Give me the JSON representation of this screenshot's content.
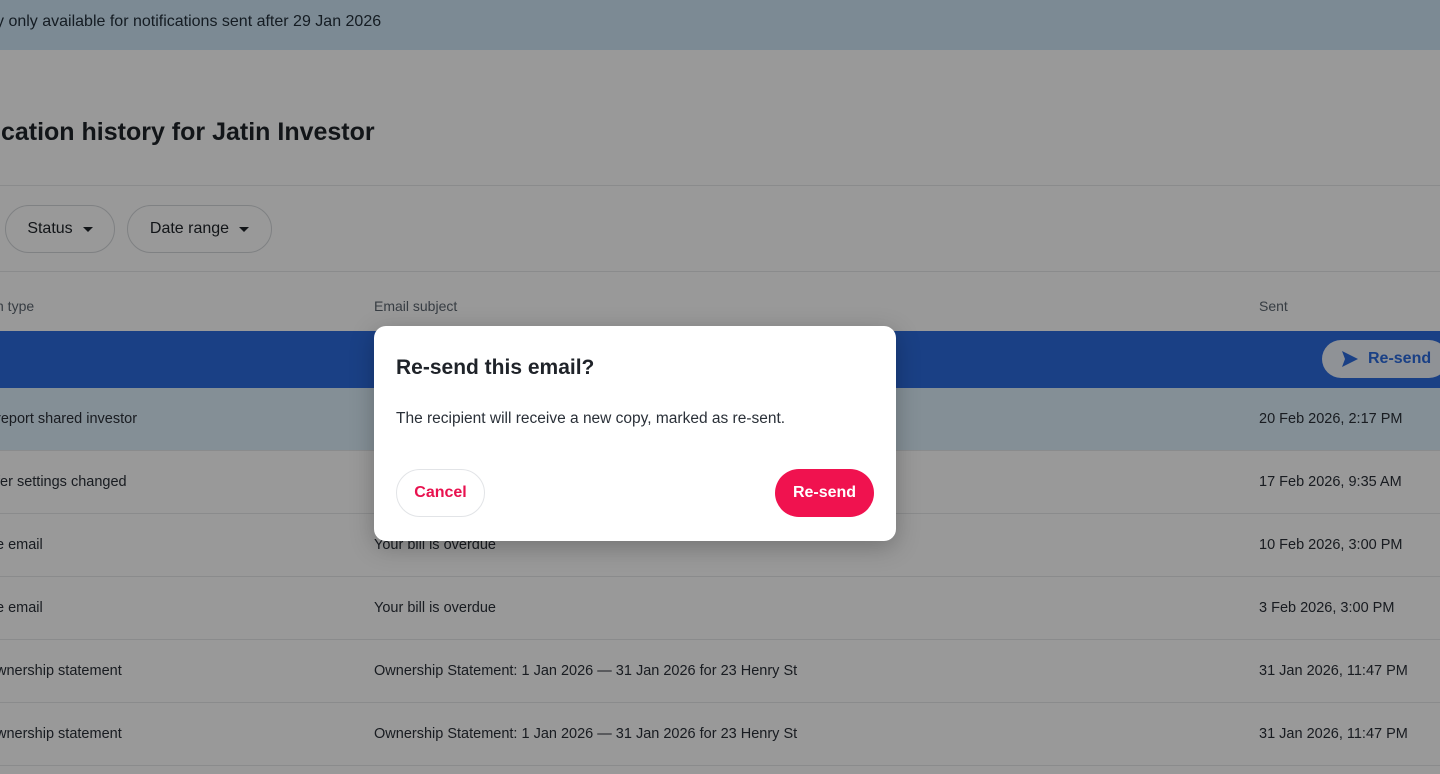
{
  "banner": {
    "text": "y only available for notifications sent after 29 Jan 2026"
  },
  "page": {
    "title": "ication history for Jatin Investor"
  },
  "filters": [
    {
      "label": "Status"
    },
    {
      "label": "Date range"
    }
  ],
  "table": {
    "columns": {
      "type": "n type",
      "subject": "Email subject",
      "sent": "Sent"
    },
    "selected_row": {
      "action_label": "Re-send",
      "action_icon": "send-icon"
    },
    "rows": [
      {
        "type": "report shared investor",
        "subject": "",
        "sent": "20 Feb 2026, 2:17 PM"
      },
      {
        "type": "fer settings changed",
        "subject": "",
        "sent": "17 Feb 2026, 9:35 AM"
      },
      {
        "type": "e email",
        "subject": "Your bill is overdue",
        "sent": "10 Feb 2026, 3:00 PM"
      },
      {
        "type": "e email",
        "subject": "Your bill is overdue",
        "sent": "3 Feb 2026, 3:00 PM"
      },
      {
        "type": "wnership statement",
        "subject": "Ownership Statement: 1 Jan 2026 — 31 Jan 2026 for 23 Henry St",
        "sent": "31 Jan 2026, 11:47 PM"
      },
      {
        "type": "wnership statement",
        "subject": "Ownership Statement: 1 Jan 2026 — 31 Jan 2026 for 23 Henry St",
        "sent": "31 Jan 2026, 11:47 PM"
      }
    ]
  },
  "dialog": {
    "title": "Re-send this email?",
    "body": "The recipient will receive a new copy, marked as re-sent.",
    "cancel_label": "Cancel",
    "confirm_label": "Re-send"
  },
  "colors": {
    "accent": "#f0124f",
    "selected_row": "#2c6bde",
    "banner": "#cfe7f7"
  }
}
